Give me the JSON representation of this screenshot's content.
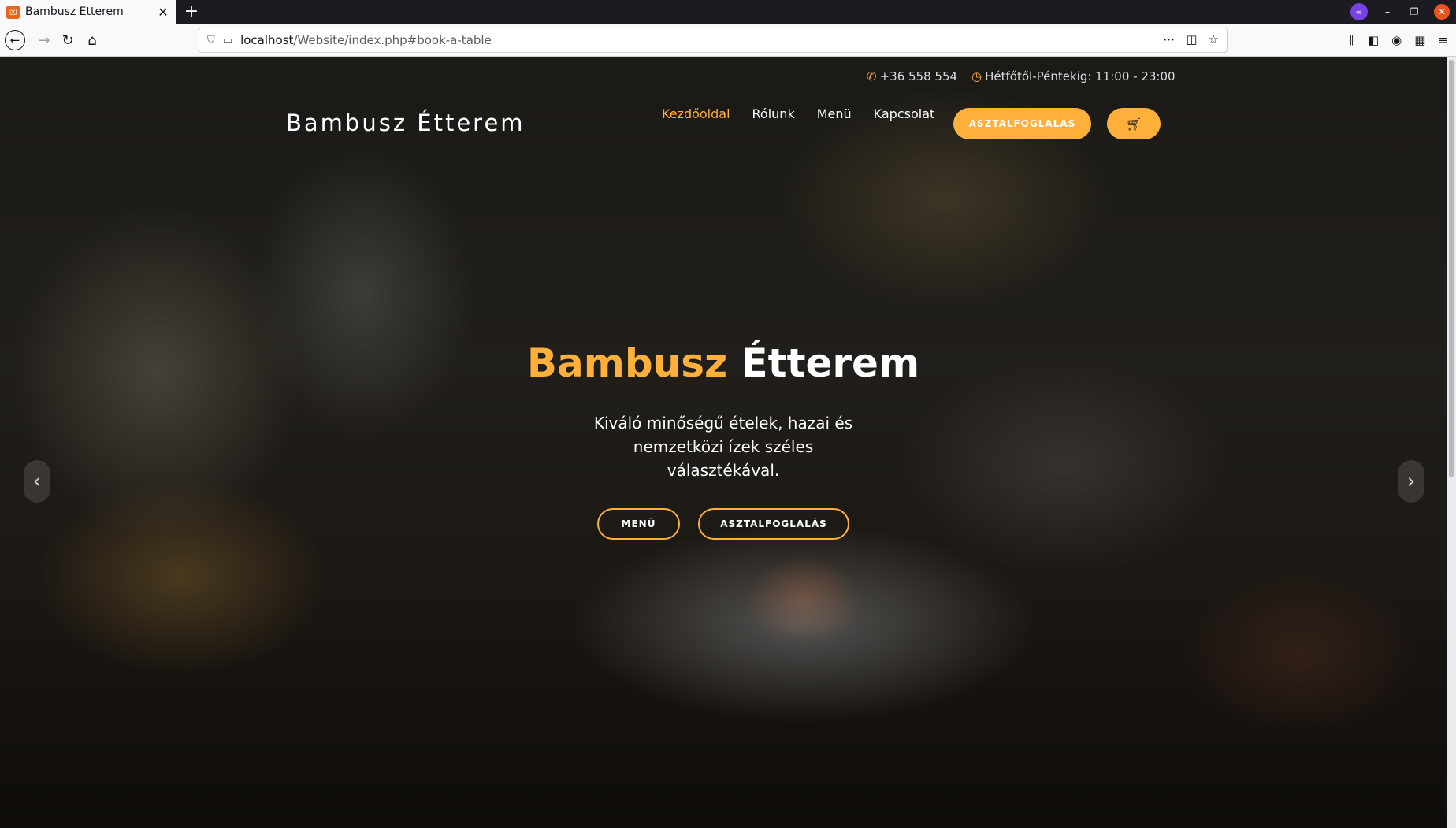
{
  "browser": {
    "tab_title": "Bambusz Étterem",
    "tab_close": "✕",
    "new_tab": "+",
    "url_host": "localhost",
    "url_path": "/Website/index.php#book-a-table"
  },
  "topbar": {
    "phone": "+36 558 554",
    "hours": "Hétfőtől-Péntekig: 11:00 - 23:00"
  },
  "header": {
    "brand": "Bambusz Étterem",
    "nav": [
      "Kezdőoldal",
      "Rólunk",
      "Menü",
      "Kapcsolat"
    ],
    "active_nav": "Kezdőoldal",
    "book_button": "ASZTALFOGLALÁS",
    "cart_icon": "cart-icon"
  },
  "hero": {
    "title_accent": "Bambusz",
    "title_rest": "Étterem",
    "subtitle": "Kiváló minőségű ételek, hazai és nemzetközi ízek széles választékával.",
    "btn_menu": "MENÜ",
    "btn_book": "ASZTALFOGLALÁS"
  },
  "colors": {
    "accent": "#ffb03b",
    "browser_dark": "#1c1b22",
    "browser_light": "#f9f9fb"
  }
}
